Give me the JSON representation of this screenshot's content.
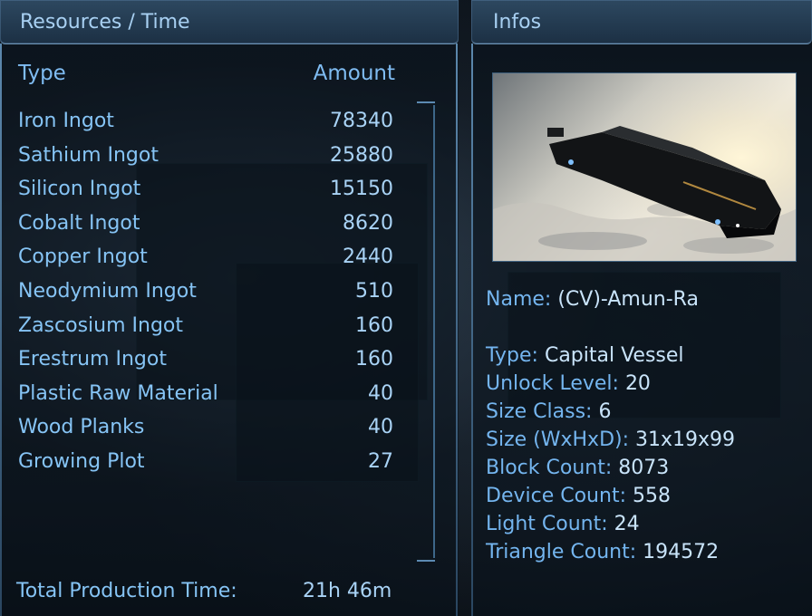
{
  "left_panel": {
    "title": "Resources / Time",
    "columns": {
      "type": "Type",
      "amount": "Amount"
    },
    "rows": [
      {
        "name": "Iron Ingot",
        "amount": "78340"
      },
      {
        "name": "Sathium Ingot",
        "amount": "25880"
      },
      {
        "name": "Silicon Ingot",
        "amount": "15150"
      },
      {
        "name": "Cobalt Ingot",
        "amount": "8620"
      },
      {
        "name": "Copper Ingot",
        "amount": "2440"
      },
      {
        "name": "Neodymium Ingot",
        "amount": "510"
      },
      {
        "name": "Zascosium Ingot",
        "amount": "160"
      },
      {
        "name": "Erestrum Ingot",
        "amount": "160"
      },
      {
        "name": "Plastic Raw Material",
        "amount": "40"
      },
      {
        "name": "Wood Planks",
        "amount": "40"
      },
      {
        "name": "Growing Plot",
        "amount": "27"
      }
    ],
    "footer": {
      "label": "Total Production Time:",
      "value": "21h 46m"
    }
  },
  "right_panel": {
    "title": "Infos",
    "name": {
      "label": "Name:",
      "value": "(CV)-Amun-Ra"
    },
    "details": [
      {
        "label": "Type:",
        "value": "Capital Vessel"
      },
      {
        "label": "Unlock Level:",
        "value": "20"
      },
      {
        "label": "Size Class:",
        "value": "6"
      },
      {
        "label": "Size (WxHxD):",
        "value": "31x19x99"
      },
      {
        "label": "Block Count:",
        "value": "8073"
      },
      {
        "label": "Device Count:",
        "value": "558"
      },
      {
        "label": "Light Count:",
        "value": "24"
      },
      {
        "label": "Triangle Count:",
        "value": "194572"
      }
    ]
  },
  "colors": {
    "accent": "#86c4f5",
    "header": "#2d4860",
    "value": "#c9e4fa"
  }
}
